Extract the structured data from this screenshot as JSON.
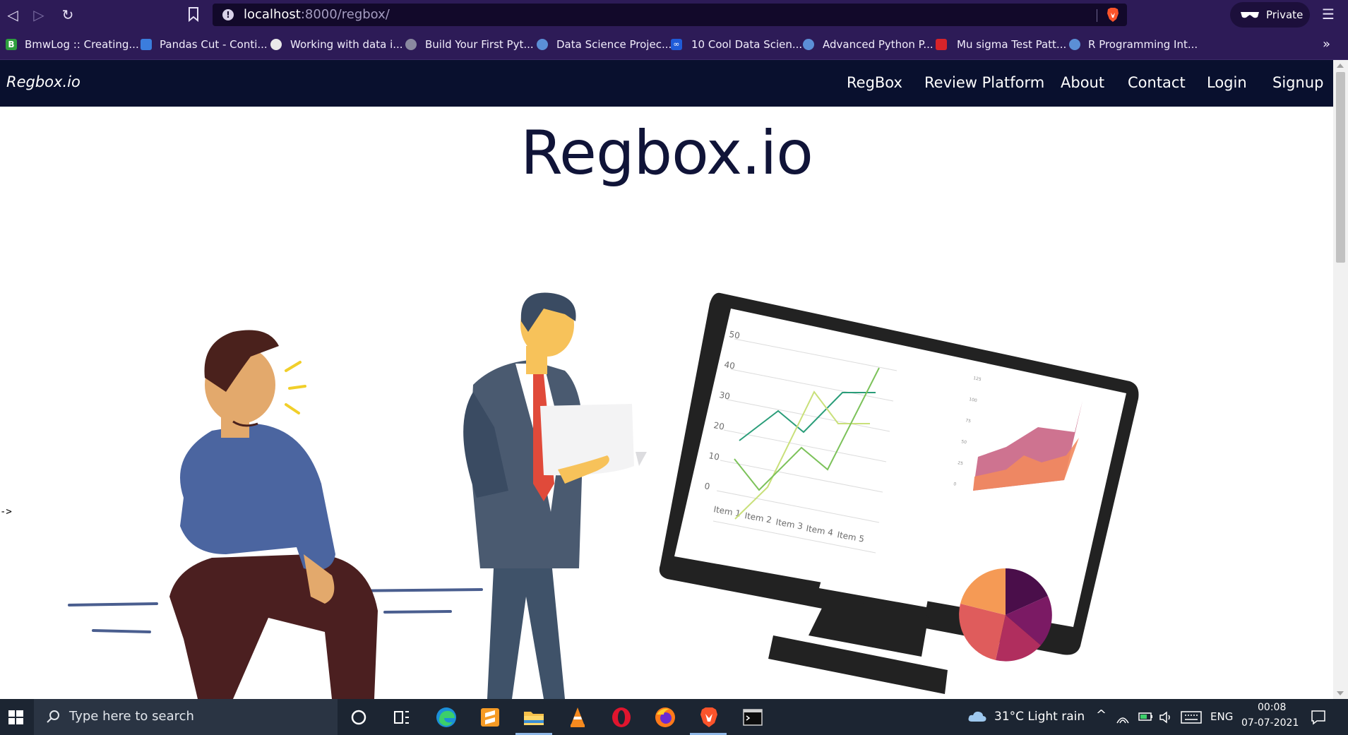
{
  "browser": {
    "url_host": "localhost",
    "url_rest": ":8000/regbox/",
    "private_label": "Private",
    "bookmarks": [
      {
        "label": "BmwLog :: Creating...",
        "icon": "bmwlog-icon",
        "color": "#2e9e3e"
      },
      {
        "label": "Pandas Cut - Conti...",
        "icon": "pandas-icon",
        "color": "#3b7ddd"
      },
      {
        "label": "Working with data i...",
        "icon": "globe-icon",
        "color": "#e9e9e9"
      },
      {
        "label": "Build Your First Pyt...",
        "icon": "cube-icon",
        "color": "#8a8aa0"
      },
      {
        "label": "Data Science Projec...",
        "icon": "dsp-icon",
        "color": "#5b8fd6"
      },
      {
        "label": "10 Cool Data Scien...",
        "icon": "infinity-icon",
        "color": "#1f5bd8"
      },
      {
        "label": "Advanced Python P...",
        "icon": "python-icon",
        "color": "#5b8fd6"
      },
      {
        "label": "Mu sigma Test Patt...",
        "icon": "musigma-icon",
        "color": "#d8242a"
      },
      {
        "label": "R Programming Int...",
        "icon": "r-icon",
        "color": "#5b8fd6"
      }
    ],
    "more_label": "»"
  },
  "page": {
    "brand": "Regbox.io",
    "nav": [
      "RegBox",
      "Review Platform",
      "About",
      "Contact",
      "Login",
      "Signup"
    ],
    "hero_title": "Regbox.io",
    "stray_text": "->",
    "monitor_chart": {
      "y_ticks": [
        "50",
        "40",
        "30",
        "20",
        "10",
        "0"
      ],
      "x_ticks": [
        "Item 1",
        "Item 2",
        "Item 3",
        "Item 4",
        "Item 5"
      ],
      "area_y_ticks": [
        "125",
        "100",
        "75",
        "50",
        "25",
        "0"
      ]
    }
  },
  "taskbar": {
    "search_placeholder": "Type here to search",
    "weather": "31°C  Light rain",
    "language": "ENG",
    "time": "00:08",
    "date": "07-07-2021"
  },
  "colors": {
    "browser_chrome": "#2d1b57",
    "navbar": "#09102e",
    "hero_text": "#101438",
    "taskbar": "#1c2532"
  }
}
